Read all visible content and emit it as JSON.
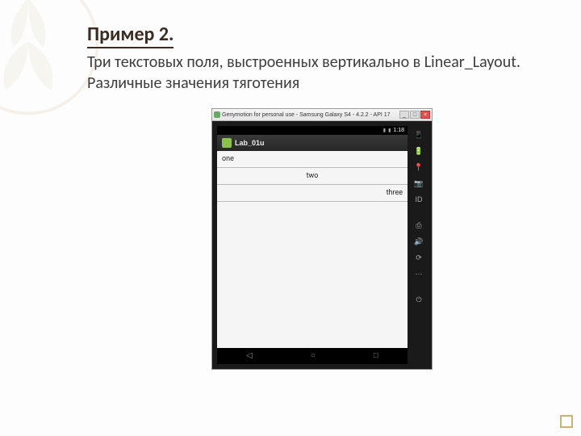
{
  "slide": {
    "title": "Пример 2.",
    "desc_line1": "Три текстовых поля, выстроенных вертикально в Linear_Layout.",
    "desc_line2": "Различные значения тяготения"
  },
  "emulator": {
    "window_title": "Genymotion for personal use - Samsung Galaxy S4 - 4.2.2 - API 17",
    "min": "_",
    "max": "□",
    "close": "×",
    "status_time": "1:18",
    "app_title": "Lab_01u",
    "rows": {
      "one": "one",
      "two": "two",
      "three": "three"
    },
    "nav": {
      "back": "◁",
      "home": "○",
      "recent": "□"
    },
    "side": {
      "phone": "📱",
      "battery": "🔋",
      "gps": "📍",
      "camera": "📷",
      "id": "ID",
      "screenshot": "⎙",
      "volume": "🔊",
      "rotate": "⟳",
      "more": "⋯",
      "power": "⏻"
    }
  }
}
